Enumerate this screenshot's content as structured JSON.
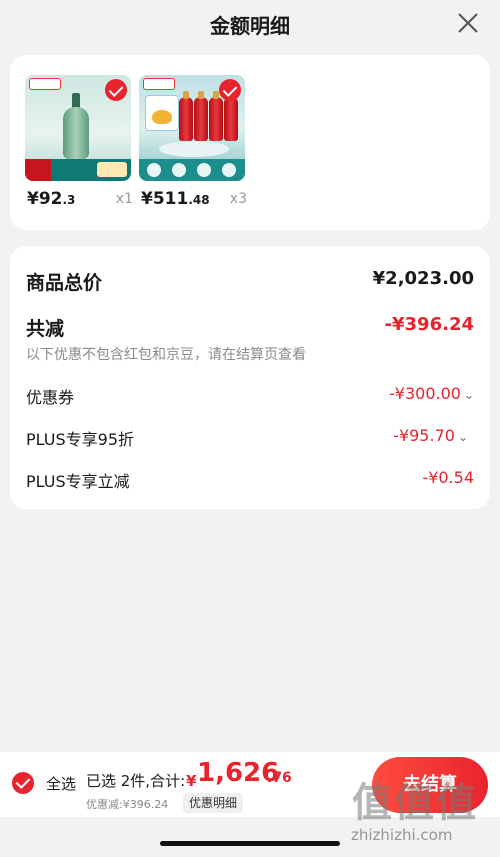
{
  "header": {
    "title": "金额明细"
  },
  "products": [
    {
      "price_main": "¥92",
      "price_small": ".3",
      "qty": "x1"
    },
    {
      "price_main": "¥511",
      "price_small": ".48",
      "qty": "x3"
    }
  ],
  "summary": {
    "total_label": "商品总价",
    "total_value": "¥2,023.00",
    "discount_label": "共减",
    "discount_value": "-¥396.24",
    "note": "以下优惠不包含红包和京豆，请在结算页查看",
    "lines": [
      {
        "label": "优惠券",
        "value": "-¥300.00",
        "chevron": "⌄"
      },
      {
        "label": "PLUS专享95折",
        "value": "-¥95.70",
        "chevron": "⌄"
      },
      {
        "label": "PLUS专享立减",
        "value": "-¥0.54"
      }
    ]
  },
  "bottom_bar": {
    "select_all_label": "全选",
    "selected_text": "已选 2件,合计:",
    "pay_currency": "¥",
    "pay_integer": "1,626",
    "pay_decimal": ".76",
    "saved_text": "优惠减:¥396.24",
    "detail_button": "优惠明细",
    "checkout_button": "去结算"
  },
  "watermark": {
    "glyphs": "值值值",
    "url": "zhizhizhi.com"
  },
  "colors": {
    "accent": "#e8232d",
    "background": "#f2f2f2",
    "card": "#ffffff"
  }
}
